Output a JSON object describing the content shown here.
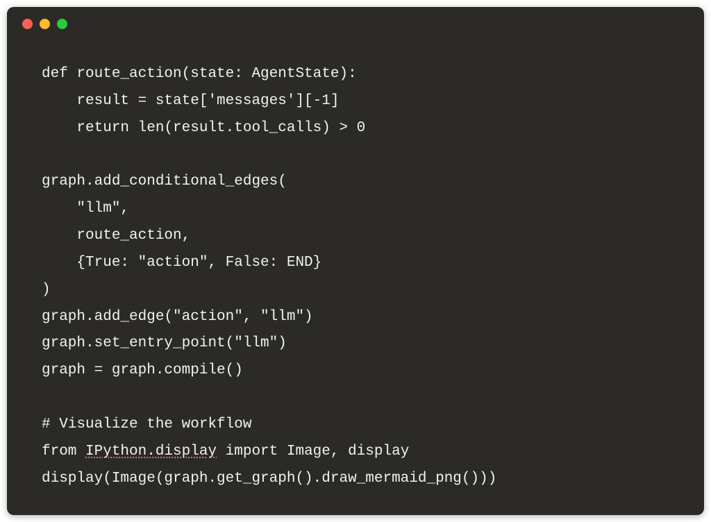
{
  "window": {
    "traffic_lights": [
      "close",
      "minimize",
      "maximize"
    ]
  },
  "code": {
    "lines": [
      "def route_action(state: AgentState):",
      "    result = state['messages'][-1]",
      "    return len(result.tool_calls) > 0",
      "",
      "graph.add_conditional_edges(",
      "    \"llm\",",
      "    route_action,",
      "    {True: \"action\", False: END}",
      ")",
      "graph.add_edge(\"action\", \"llm\")",
      "graph.set_entry_point(\"llm\")",
      "graph = graph.compile()",
      "",
      "# Visualize the workflow",
      "from IPython.display import Image, display",
      "display(Image(graph.get_graph().draw_mermaid_png()))"
    ],
    "squiggle_token": "IPython.display",
    "squiggle_line_index": 14
  }
}
